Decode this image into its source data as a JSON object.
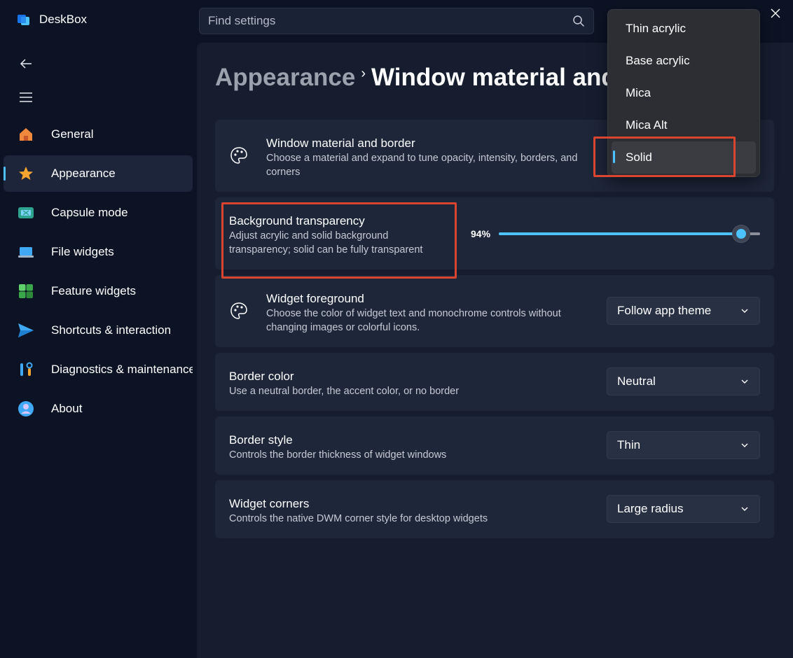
{
  "app": {
    "title": "DeskBox"
  },
  "search": {
    "placeholder": "Find settings"
  },
  "sidebar": {
    "items": [
      {
        "label": "General",
        "icon": "home-icon"
      },
      {
        "label": "Appearance",
        "icon": "star-icon",
        "active": true
      },
      {
        "label": "Capsule mode",
        "icon": "capsule-icon"
      },
      {
        "label": "File widgets",
        "icon": "laptop-icon"
      },
      {
        "label": "Feature widgets",
        "icon": "grid-icon"
      },
      {
        "label": "Shortcuts & interaction",
        "icon": "send-icon"
      },
      {
        "label": "Diagnostics & maintenance",
        "icon": "tools-icon"
      },
      {
        "label": "About",
        "icon": "person-icon"
      }
    ]
  },
  "breadcrumb": {
    "parent": "Appearance",
    "separator": "›",
    "current": "Window material and border"
  },
  "cards": {
    "window_material": {
      "title": "Window material and border",
      "desc": "Choose a material and expand to tune opacity, intensity, borders, and corners"
    },
    "background_transparency": {
      "title": "Background transparency",
      "desc": "Adjust acrylic and solid background transparency; solid can be fully transparent",
      "value_label": "94%",
      "value": 94
    },
    "widget_foreground": {
      "title": "Widget foreground",
      "desc": "Choose the color of widget text and monochrome controls without changing images or colorful icons.",
      "selected": "Follow app theme"
    },
    "border_color": {
      "title": "Border color",
      "desc": "Use a neutral border, the accent color, or no border",
      "selected": "Neutral"
    },
    "border_style": {
      "title": "Border style",
      "desc": "Controls the border thickness of widget windows",
      "selected": "Thin"
    },
    "widget_corners": {
      "title": "Widget corners",
      "desc": "Controls the native DWM corner style for desktop widgets",
      "selected": "Large radius"
    }
  },
  "flyout": {
    "options": [
      "Thin acrylic",
      "Base acrylic",
      "Mica",
      "Mica Alt",
      "Solid"
    ],
    "selected": "Solid"
  },
  "colors": {
    "accent": "#4cc2ff",
    "highlight": "#d9452f",
    "background": "#0c1324",
    "card": "#1e263a"
  }
}
